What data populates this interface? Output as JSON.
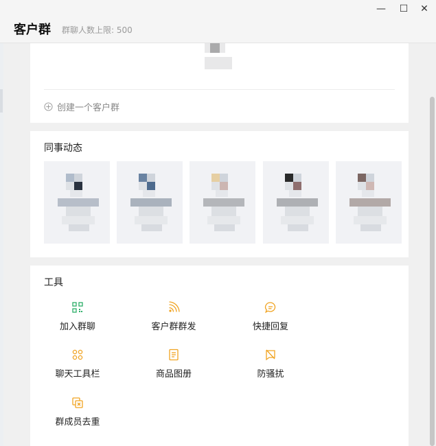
{
  "header": {
    "title": "客户群",
    "subtitle": "群聊人数上限: 500"
  },
  "window": {
    "minimize_glyph": "—",
    "maximize_glyph": "☐",
    "close_glyph": "✕"
  },
  "groups_card": {
    "create_label": "创建一个客户群"
  },
  "colleague_feed": {
    "title": "同事动态",
    "tiles": [
      {
        "head_colors": [
          "#b0bccb",
          "#2a3340"
        ],
        "skin": "#b7bec9"
      },
      {
        "head_colors": [
          "#6a83a2",
          "#4e6b8e"
        ],
        "skin": "#aab2bd"
      },
      {
        "head_colors": [
          "#e6cfa3",
          "#ccb6b2"
        ],
        "skin": "#b4b6ba"
      },
      {
        "head_colors": [
          "#2a2a2a",
          "#8f6f6f"
        ],
        "skin": "#aeb0b4"
      },
      {
        "head_colors": [
          "#7c6763",
          "#cfb8b4"
        ],
        "skin": "#b2a9a7"
      }
    ]
  },
  "tools": {
    "title": "工具",
    "items": [
      {
        "label": "加入群聊",
        "icon": "qr-code-icon",
        "color": "#2bae67"
      },
      {
        "label": "客户群群发",
        "icon": "broadcast-icon",
        "color": "#f0a321"
      },
      {
        "label": "快捷回复",
        "icon": "chat-bubble-icon",
        "color": "#f0a321"
      },
      {
        "label": "聊天工具栏",
        "icon": "toolbar-grid-icon",
        "color": "#f0a321"
      },
      {
        "label": "商品图册",
        "icon": "catalog-icon",
        "color": "#f0a321"
      },
      {
        "label": "防骚扰",
        "icon": "anti-harassment-icon",
        "color": "#f0a321"
      },
      {
        "label": "群成员去重",
        "icon": "dedupe-icon",
        "color": "#f0a321"
      }
    ]
  }
}
